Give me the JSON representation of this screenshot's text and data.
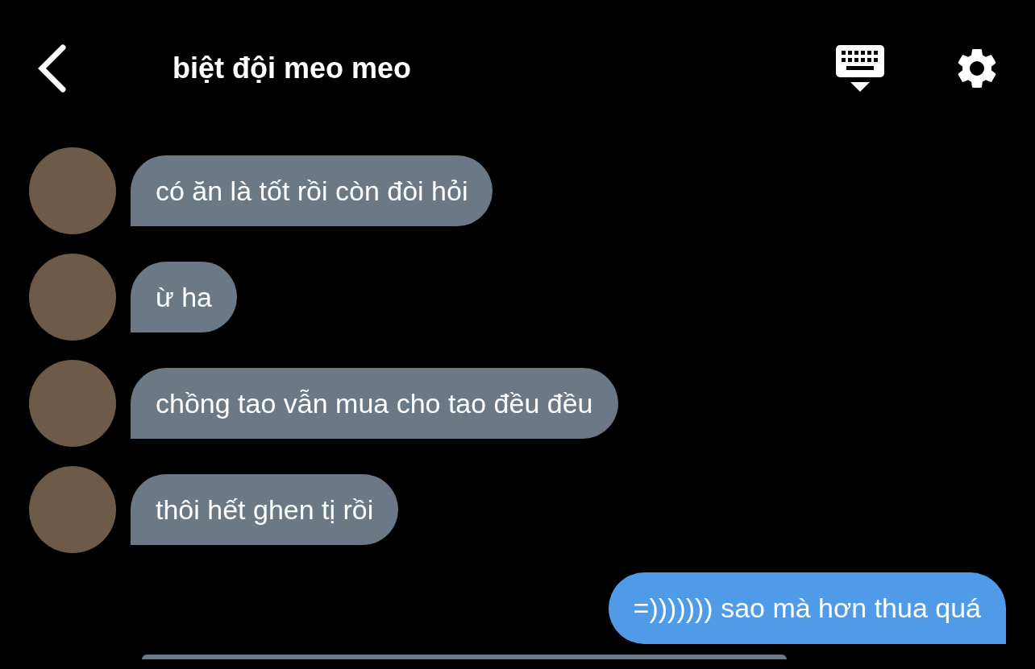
{
  "header": {
    "title": "biệt đội meo meo"
  },
  "messages": [
    {
      "kind": "text",
      "outgoing": false,
      "text": "có ăn là tốt rồi còn đòi hỏi"
    },
    {
      "kind": "text",
      "outgoing": false,
      "text": "ừ ha"
    },
    {
      "kind": "text",
      "outgoing": false,
      "text": "chồng tao vẫn mua cho tao đều đều"
    },
    {
      "kind": "text",
      "outgoing": false,
      "text": "thôi hết ghen tị rồi"
    },
    {
      "kind": "text",
      "outgoing": true,
      "text": "=))))))) sao mà hơn thua quá"
    },
    {
      "kind": "cut_off",
      "outgoing": false
    }
  ]
}
